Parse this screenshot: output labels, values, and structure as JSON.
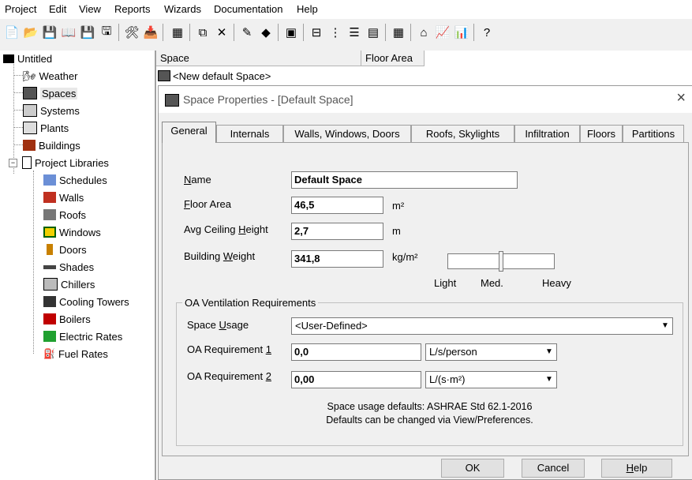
{
  "menu": [
    "Project",
    "Edit",
    "View",
    "Reports",
    "Wizards",
    "Documentation",
    "Help"
  ],
  "tree": {
    "root": "Untitled",
    "items": [
      "Weather",
      "Spaces",
      "Systems",
      "Plants",
      "Buildings"
    ],
    "libraries_label": "Project Libraries",
    "libraries": [
      "Schedules",
      "Walls",
      "Roofs",
      "Windows",
      "Doors",
      "Shades",
      "Chillers",
      "Cooling Towers",
      "Boilers",
      "Electric Rates",
      "Fuel Rates"
    ]
  },
  "list": {
    "columns": [
      "Space",
      "Floor Area"
    ],
    "rows": [
      "<New default Space>"
    ]
  },
  "dialog": {
    "title": "Space Properties - [Default Space]",
    "close": "×",
    "tabs": [
      "General",
      "Internals",
      "Walls, Windows, Doors",
      "Roofs, Skylights",
      "Infiltration",
      "Floors",
      "Partitions"
    ],
    "active_tab": "General",
    "name_label": {
      "u": "N",
      "rest": "ame"
    },
    "name_value": "Default Space",
    "floor_area_label": {
      "u": "F",
      "rest": "loor Area"
    },
    "floor_area_value": "46,5",
    "floor_area_unit": "m²",
    "ceiling_label": {
      "pre": "Avg Ceiling ",
      "u": "H",
      "rest": "eight"
    },
    "ceiling_value": "2,7",
    "ceiling_unit": "m",
    "weight_label": {
      "pre": "Building ",
      "u": "W",
      "rest": "eight"
    },
    "weight_value": "341,8",
    "weight_unit": "kg/m²",
    "weight_scale": {
      "light": "Light",
      "med": "Med.",
      "heavy": "Heavy",
      "position": 0.5
    },
    "oa_group": "OA Ventilation Requirements",
    "space_usage_label": {
      "pre": "Space ",
      "u": "U",
      "rest": "sage"
    },
    "space_usage_value": "<User-Defined>",
    "oa1_label": {
      "pre": "OA Requirement ",
      "u": "1"
    },
    "oa1_value": "0,0",
    "oa1_unit": "L/s/person",
    "oa2_label": {
      "pre": "OA Requirement ",
      "u": "2"
    },
    "oa2_value": "0,00",
    "oa2_unit": "L/(s·m²)",
    "defaults_line1": "Space usage defaults: ASHRAE Std 62.1-2016",
    "defaults_line2": "Defaults can be changed via View/Preferences.",
    "ok": "OK",
    "cancel": "Cancel",
    "help": {
      "u": "H",
      "rest": "elp"
    }
  },
  "colors": {
    "accent": "#0078d7",
    "folder": "#c8a000",
    "red": "#c00000"
  }
}
